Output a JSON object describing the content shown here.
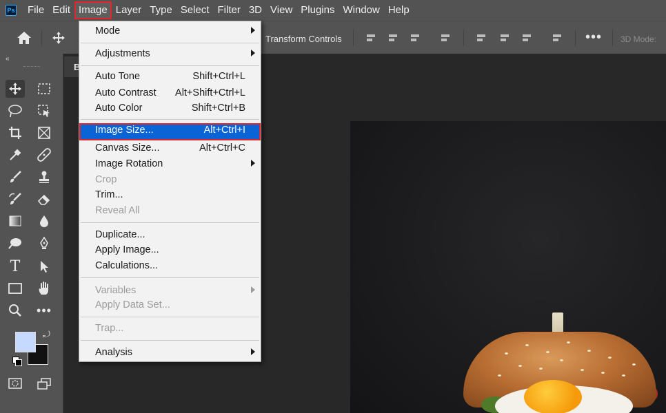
{
  "app": {
    "logo": "Ps",
    "menubar": [
      "File",
      "Edit",
      "Image",
      "Layer",
      "Type",
      "Select",
      "Filter",
      "3D",
      "View",
      "Plugins",
      "Window",
      "Help"
    ],
    "active_menu": "Image"
  },
  "options_bar": {
    "transform_label": "Transform Controls",
    "mode_3d": "3D Mode:",
    "icons": [
      "home-icon",
      "move-icon",
      "more-icon"
    ]
  },
  "toolbar": {
    "collapse": "«",
    "tools": [
      "move",
      "marquee",
      "lasso",
      "object-select",
      "crop",
      "frame",
      "eyedropper",
      "healing",
      "brush",
      "stamp",
      "history-brush",
      "eraser",
      "gradient",
      "blur",
      "dodge",
      "pen",
      "type",
      "path-select",
      "rectangle",
      "hand",
      "zoom",
      "more"
    ],
    "foreground_color": "#c6d9ff",
    "background_color": "#111111"
  },
  "document": {
    "tab_letter": "B"
  },
  "image_menu": {
    "items": [
      {
        "label": "Mode",
        "shortcut": "",
        "submenu": true,
        "disabled": false
      },
      {
        "label": "Adjustments",
        "shortcut": "",
        "submenu": true,
        "disabled": false
      },
      {
        "label": "Auto Tone",
        "shortcut": "Shift+Ctrl+L",
        "submenu": false,
        "disabled": false
      },
      {
        "label": "Auto Contrast",
        "shortcut": "Alt+Shift+Ctrl+L",
        "submenu": false,
        "disabled": false
      },
      {
        "label": "Auto Color",
        "shortcut": "Shift+Ctrl+B",
        "submenu": false,
        "disabled": false
      },
      {
        "label": "Image Size...",
        "shortcut": "Alt+Ctrl+I",
        "submenu": false,
        "disabled": false,
        "highlighted": true
      },
      {
        "label": "Canvas Size...",
        "shortcut": "Alt+Ctrl+C",
        "submenu": false,
        "disabled": false
      },
      {
        "label": "Image Rotation",
        "shortcut": "",
        "submenu": true,
        "disabled": false
      },
      {
        "label": "Crop",
        "shortcut": "",
        "submenu": false,
        "disabled": true
      },
      {
        "label": "Trim...",
        "shortcut": "",
        "submenu": false,
        "disabled": false
      },
      {
        "label": "Reveal All",
        "shortcut": "",
        "submenu": false,
        "disabled": true
      },
      {
        "label": "Duplicate...",
        "shortcut": "",
        "submenu": false,
        "disabled": false
      },
      {
        "label": "Apply Image...",
        "shortcut": "",
        "submenu": false,
        "disabled": false
      },
      {
        "label": "Calculations...",
        "shortcut": "",
        "submenu": false,
        "disabled": false
      },
      {
        "label": "Variables",
        "shortcut": "",
        "submenu": true,
        "disabled": true
      },
      {
        "label": "Apply Data Set...",
        "shortcut": "",
        "submenu": false,
        "disabled": true
      },
      {
        "label": "Trap...",
        "shortcut": "",
        "submenu": false,
        "disabled": true
      },
      {
        "label": "Analysis",
        "shortcut": "",
        "submenu": true,
        "disabled": false
      }
    ]
  },
  "colors": {
    "highlight": "#0a64d6",
    "annotation_red": "#e0262a",
    "ui_gray": "#535353"
  }
}
